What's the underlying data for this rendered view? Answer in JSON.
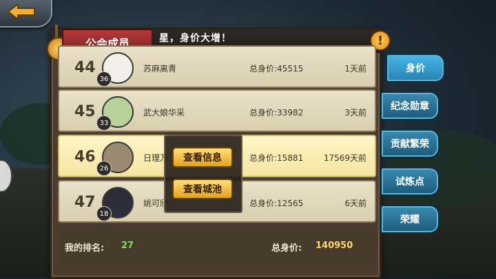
{
  "marquee": "星，身价大增！",
  "title": "公会成员",
  "info_icon": "!",
  "rows": [
    {
      "rank": "44",
      "level": "36",
      "name": "苏麻离青",
      "worth": "总身价:45515",
      "days": "1天前",
      "avatar_color": "#f2eee8"
    },
    {
      "rank": "45",
      "level": "33",
      "name": "武大娘华采",
      "worth": "总身价:33982",
      "days": "3天前",
      "avatar_color": "#b7d39a"
    },
    {
      "rank": "46",
      "level": "26",
      "name": "日理万",
      "worth": "总身价:15881",
      "days": "17569天前",
      "avatar_color": "#9b8a70"
    },
    {
      "rank": "47",
      "level": "18",
      "name": "姚可欣",
      "worth": "总身价:12565",
      "days": "6天前",
      "avatar_color": "#2e2e3a"
    }
  ],
  "popup": {
    "view_info": "查看信息",
    "view_city": "查看城池"
  },
  "footer": {
    "my_rank_label": "我的排名:",
    "my_rank": "27",
    "total_label": "总身价:",
    "total": "140950"
  },
  "tabs": [
    "身价",
    "纪念勋章",
    "贡献繁荣",
    "试炼点",
    "荣耀"
  ]
}
